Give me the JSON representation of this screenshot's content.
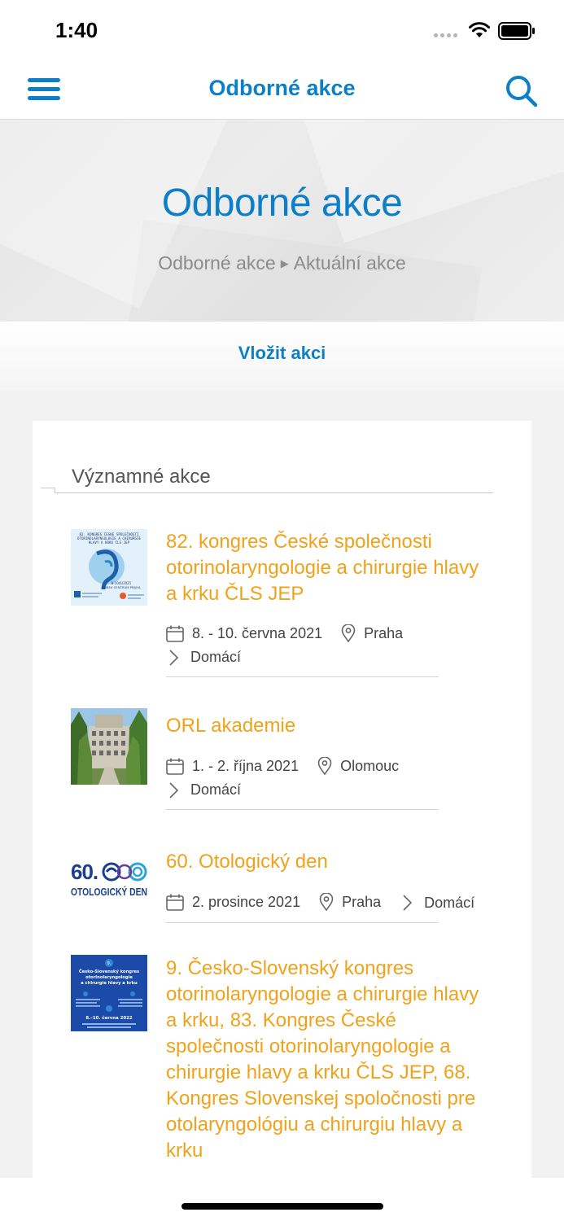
{
  "status": {
    "time": "1:40"
  },
  "nav": {
    "title": "Odborné akce"
  },
  "hero": {
    "title": "Odborné akce",
    "breadcrumb": [
      "Odborné akce",
      "Aktuální akce"
    ]
  },
  "insert_button": "Vložit akci",
  "section_title": "Významné akce",
  "events": [
    {
      "title": "82. kongres České společnosti otorinolaryngologie a chirurgie hlavy a krku ČLS JEP",
      "date": "8. - 10. června 2021",
      "place": "Praha",
      "category": "Domácí",
      "thumb_text": [
        "82. KONGRES ČESKÉ SPOLEČNOSTI",
        "OTORINOLARYNGOLOGIE A CHIRURGIE",
        "HLAVY A KRKU ČLS JEP",
        "8-10/6/2021",
        "CUBEX CENTRUM PRAHA"
      ]
    },
    {
      "title": "ORL akademie",
      "date": "1. - 2. října 2021",
      "place": "Olomouc",
      "category": "Domácí"
    },
    {
      "title": "60. Otologický den",
      "date": "2. prosince 2021",
      "place": "Praha",
      "category": "Domácí",
      "thumb_text": [
        "60.",
        "OTOLOGICKÝ DEN"
      ]
    },
    {
      "title": "9. Česko-Slovenský  kongres otorinolaryngologie a chirurgie hlavy a krku, 83. Kongres České společnosti otorinolaryngologie a chirurgie hlavy a krku ČLS JEP, 68. Kongres Slovenskej spoločnosti pre otolaryngológiu a chirurgiu hlavy a krku",
      "thumb_text": [
        "9.",
        "Česko-Slovenský kongres",
        "otorinolaryngologie",
        "a chirurgie hlavy a krku",
        "8.–10. června 2022"
      ]
    }
  ],
  "colors": {
    "accent": "#0d7fc8",
    "event_title": "#f0a21a"
  }
}
